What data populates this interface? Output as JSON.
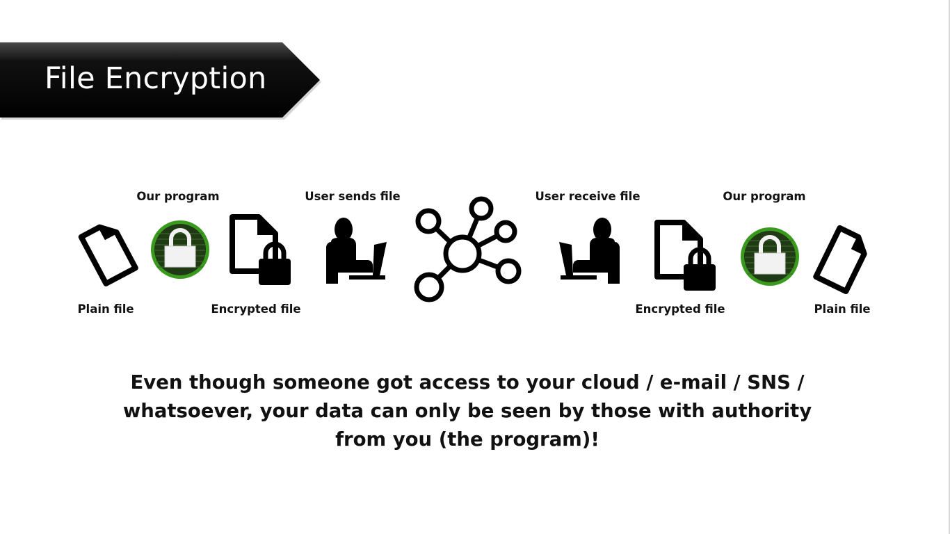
{
  "slide": {
    "title": "File Encryption",
    "colors": {
      "banner": "#000000",
      "lock_green": "#3a9a1e",
      "text": "#111111"
    }
  },
  "diagram": {
    "top_labels": {
      "program_left": "Our program",
      "user_sends": "User sends file",
      "user_receive": "User receive file",
      "program_right": "Our program"
    },
    "bottom_labels": {
      "plain_left": "Plain file",
      "encrypted_left": "Encrypted file",
      "encrypted_right": "Encrypted file",
      "plain_right": "Plain file"
    },
    "icons": [
      "plain-file-icon",
      "green-lock-icon",
      "encrypted-file-icon",
      "user-laptop-icon",
      "network-hub-icon",
      "user-laptop-icon",
      "encrypted-file-icon",
      "green-lock-icon",
      "plain-file-icon"
    ]
  },
  "caption": "Even though someone got access to your cloud / e-mail / SNS / whatsoever, your data can only be seen by those with authority from you (the program)!"
}
